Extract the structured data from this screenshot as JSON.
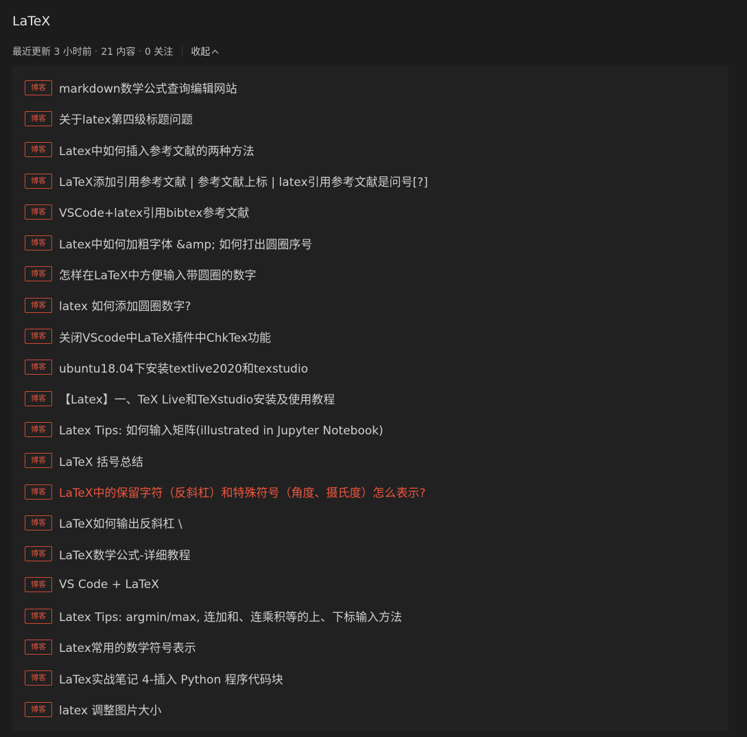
{
  "header": {
    "title": "LaTeX",
    "updated": "最近更新 3 小时前",
    "content_count": "21 内容",
    "follow_count": "0 关注",
    "collapse_label": "收起"
  },
  "colors": {
    "accent": "#f0553e",
    "badge_border": "#d24a35",
    "background": "#1c1c1c",
    "panel": "#212121"
  },
  "list": {
    "badge_label": "博客",
    "active_index": 13,
    "items": [
      {
        "title": "markdown数学公式查询编辑网站"
      },
      {
        "title": "关于latex第四级标题问题"
      },
      {
        "title": "Latex中如何插入参考文献的两种方法"
      },
      {
        "title": "LaTeX添加引用参考文献 | 参考文献上标 | latex引用参考文献是问号[?]"
      },
      {
        "title": "VSCode+latex引用bibtex参考文献"
      },
      {
        "title": "Latex中如何加粗字体 &amp; 如何打出圆圈序号"
      },
      {
        "title": "怎样在LaTeX中方便输入带圆圈的数字"
      },
      {
        "title": "latex 如何添加圆圈数字?"
      },
      {
        "title": "关闭VScode中LaTeX插件中ChkTex功能"
      },
      {
        "title": "ubuntu18.04下安装textlive2020和texstudio"
      },
      {
        "title": "【Latex】一、TeX Live和TeXstudio安装及使用教程"
      },
      {
        "title": "Latex Tips: 如何输入矩阵(illustrated in Jupyter Notebook)"
      },
      {
        "title": "LaTeX 括号总结"
      },
      {
        "title": "LaTeX中的保留字符（反斜杠）和特殊符号（角度、摄氏度）怎么表示?"
      },
      {
        "title": "LaTeX如何输出反斜杠 \\"
      },
      {
        "title": "LaTeX数学公式-详细教程"
      },
      {
        "title": "VS Code + LaTeX"
      },
      {
        "title": "Latex Tips: argmin/max, 连加和、连乘积等的上、下标输入方法"
      },
      {
        "title": "Latex常用的数学符号表示"
      },
      {
        "title": "LaTex实战笔记 4-插入 Python 程序代码块"
      },
      {
        "title": "latex 调整图片大小"
      }
    ]
  }
}
